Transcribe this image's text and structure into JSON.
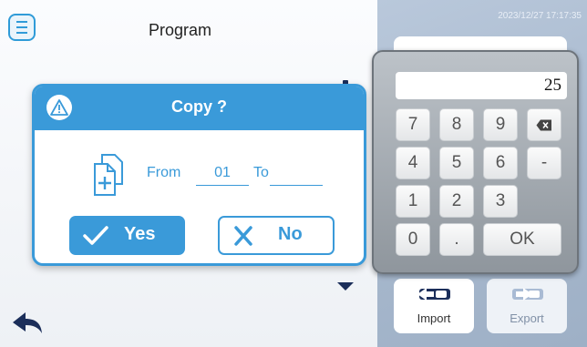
{
  "header": {
    "title": "Program",
    "datetime": "2023/12/27 17:17:35"
  },
  "dialog": {
    "title": "Copy ?",
    "from_label": "From",
    "from_value": "01",
    "to_label": "To",
    "to_value": "",
    "yes_label": "Yes",
    "no_label": "No"
  },
  "keypad": {
    "display_value": "25",
    "keys": [
      "7",
      "8",
      "9",
      "⌫",
      "4",
      "5",
      "6",
      "-",
      "1",
      "2",
      "3",
      "0",
      ".",
      "OK"
    ]
  },
  "side": {
    "import_label": "Import",
    "export_label": "Export"
  },
  "colors": {
    "accent": "#3a9ad9",
    "panel": "#a6b7cc"
  }
}
